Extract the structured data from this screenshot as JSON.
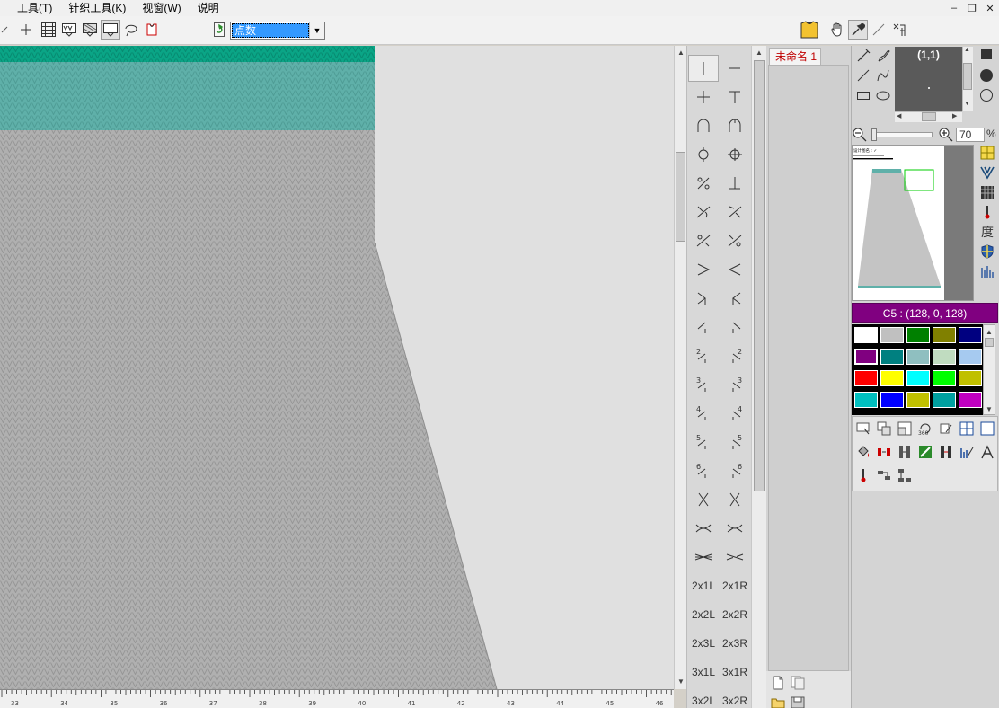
{
  "menu": {
    "items": [
      "工具(T)",
      "针织工具(K)",
      "视窗(W)",
      "说明"
    ]
  },
  "toolbar": {
    "mode_select_value": "点数"
  },
  "stitch_palette": {
    "text_items": [
      [
        "2x1L",
        "2x1R"
      ],
      [
        "2x2L",
        "2x2R"
      ],
      [
        "2x3L",
        "2x3R"
      ],
      [
        "3x1L",
        "3x1R"
      ],
      [
        "3x2L",
        "3x2R"
      ]
    ],
    "digits": [
      "2",
      "3",
      "4",
      "5",
      "6"
    ]
  },
  "documents": {
    "active_tab": "未命名 1"
  },
  "brush": {
    "coordinate": "(1,1)"
  },
  "zoom": {
    "value": "70",
    "unit": "%"
  },
  "navigator": {
    "header_text": "设计图名 : ✓"
  },
  "color": {
    "current_label": "C5 : (128, 0, 128)",
    "current_hex": "#800080"
  },
  "swatches": [
    "#ffffff",
    "#c0c0c0",
    "#008000",
    "#808000",
    "#000080",
    "#800080",
    "#008080",
    "#8fbfc0",
    "#c0dcc0",
    "#a6caf0",
    "#ff0000",
    "#ffff00",
    "#00ffff",
    "#00ff00",
    "#c0c000",
    "#00c0c0",
    "#0000ff",
    "#c0c000",
    "#00a0a0",
    "#c000c0"
  ],
  "side_tool_labels": {
    "degree": "度"
  },
  "ruler": {
    "labels": [
      "33",
      "34",
      "35",
      "36",
      "37",
      "38",
      "39",
      "40",
      "41",
      "42",
      "43",
      "44",
      "45",
      "46"
    ]
  },
  "colors": {
    "knit_gray": "#b0b0b0",
    "knit_teal": "#5fb0a9",
    "knit_teal_dark": "#09a587",
    "canvas_bg": "#e0e0e0"
  }
}
